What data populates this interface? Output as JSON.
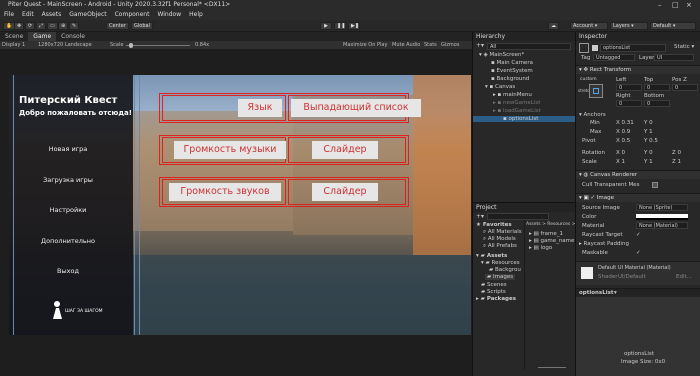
{
  "window": {
    "title": "Piter Quest - MainScreen - Android - Unity 2020.3.32f1 Personal* <DX11>"
  },
  "menu": [
    "File",
    "Edit",
    "Assets",
    "GameObject",
    "Component",
    "Window",
    "Help"
  ],
  "toolbar": {
    "center": "Center",
    "global": "Global",
    "account": "Account",
    "layers": "Layers",
    "layout": "Default"
  },
  "view_tabs": [
    "Scene",
    "Game",
    "Console"
  ],
  "game_bar": {
    "display": "Display 1",
    "resolution": "1280x720 Landscape",
    "scale_label": "Scale",
    "scale_value": "0.84x",
    "maximize": "Maximize On Play",
    "mute": "Mute Audio",
    "stats": "Stats",
    "gizmos": "Gizmos"
  },
  "game": {
    "title": "Питерский Квест",
    "subtitle": "Добро пожаловать отсюда!",
    "menu_items": [
      "Новая игра",
      "Загрузка игры",
      "Настройки",
      "Дополнительно",
      "Выход"
    ],
    "logo_text": "ШАГ ЗА ШАГОМ",
    "row1": {
      "left": "Язык",
      "right": "Выпадающий список"
    },
    "row2": {
      "left": "Громкость музыки",
      "right": "Слайдер"
    },
    "row3": {
      "left": "Громкость звуков",
      "right": "Слайдер"
    }
  },
  "hierarchy": {
    "title": "Hierarchy",
    "search": "All",
    "items": [
      "MainScreen*",
      "Main Camera",
      "EventSystem",
      "Background",
      "Canvas",
      "mainMenu",
      "newGameList",
      "loadGameList",
      "optionsList"
    ]
  },
  "project": {
    "title": "Project",
    "favorites": "Favorites",
    "fav_items": [
      "All Materials",
      "All Models",
      "All Prefabs"
    ],
    "assets": "Assets",
    "tree": [
      "Resources",
      "Backgrou",
      "Images",
      "Scenes",
      "Scripts",
      "Packages"
    ],
    "breadcrumb": "Assets > Resources > Images",
    "files": [
      "frame_1",
      "game_name",
      "logo"
    ]
  },
  "inspector": {
    "title": "Inspector",
    "object_name": "optionsList",
    "static": "Static",
    "tag_label": "Tag",
    "tag": "Untagged",
    "layer_label": "Layer",
    "layer": "UI",
    "rect_transform": "Rect Transform",
    "anchor_preset": "custom",
    "stretch": "stretch",
    "pos_headers": [
      "Left",
      "Top",
      "Pos Z"
    ],
    "pos_values": [
      "0",
      "0",
      "0"
    ],
    "size_headers": [
      "Right",
      "Bottom"
    ],
    "size_values": [
      "0",
      "0"
    ],
    "anchors": "Anchors",
    "min_label": "Min",
    "min_x": "0.31",
    "min_y": "0",
    "max_label": "Max",
    "max_x": "0.9",
    "max_y": "1",
    "pivot_label": "Pivot",
    "pivot_x": "0.5",
    "pivot_y": "0.5",
    "rotation_label": "Rotation",
    "rot": [
      "0",
      "0",
      "0"
    ],
    "scale_label": "Scale",
    "scale": [
      "1",
      "1",
      "1"
    ],
    "canvas_renderer": "Canvas Renderer",
    "cull": "Cull Transparent Mes",
    "image": "Image",
    "source_image_label": "Source Image",
    "source_image": "None (Sprite)",
    "color_label": "Color",
    "material_label": "Material",
    "material": "None (Material)",
    "raycast_target": "Raycast Target",
    "raycast_padding": "Raycast Padding",
    "maskable": "Maskable",
    "default_material": "Default UI Material (Material)",
    "shader_label": "Shader",
    "shader": "UI/Default",
    "edit": "Edit...",
    "preview_tab": "optionsList",
    "preview_name": "optionsList",
    "preview_size": "Image Size: 0x0"
  },
  "colors": {
    "accent_red": "#dd2222",
    "selection": "#2c5d87",
    "button_bg": "#e6e6e6"
  }
}
